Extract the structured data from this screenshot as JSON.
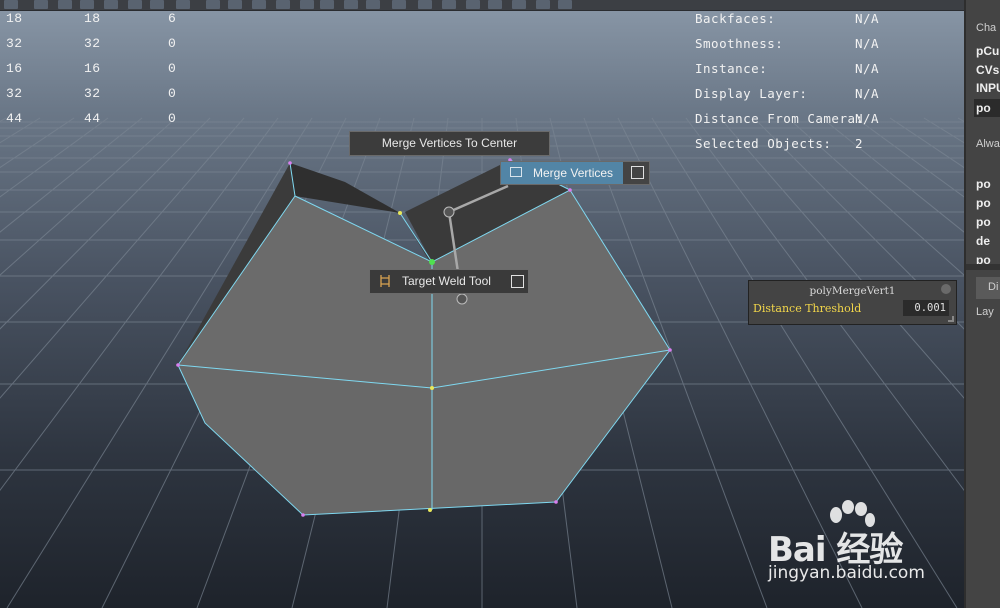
{
  "hud_left": {
    "rows": [
      [
        "18",
        "18",
        "6"
      ],
      [
        "32",
        "32",
        "0"
      ],
      [
        "16",
        "16",
        "0"
      ],
      [
        "32",
        "32",
        "0"
      ],
      [
        "44",
        "44",
        "0"
      ]
    ]
  },
  "hud_right": {
    "rows": [
      {
        "label": "Backfaces:",
        "value": "N/A"
      },
      {
        "label": "Smoothness:",
        "value": "N/A"
      },
      {
        "label": "Instance:",
        "value": "N/A"
      },
      {
        "label": "Display Layer:",
        "value": "N/A"
      },
      {
        "label": "Distance From Camera:",
        "value": "N/A"
      },
      {
        "label": "Selected Objects:",
        "value": "2"
      }
    ]
  },
  "marking_menu": {
    "merge_to_center": "Merge Vertices To Center",
    "merge_vertices": "Merge Vertices",
    "target_weld": "Target Weld Tool"
  },
  "merge_panel": {
    "title": "polyMergeVert1",
    "attr_label": "Distance Threshold",
    "attr_value": "0.001"
  },
  "side_panel": {
    "items": [
      "Cha",
      "pCu",
      "CVs",
      "INPU",
      "po",
      "Alwa",
      "po",
      "po",
      "po",
      "de",
      "po",
      "Di",
      "Lay"
    ]
  },
  "watermark": {
    "brand": "Bai 经验",
    "url": "jingyan.baidu.com"
  },
  "colors": {
    "accent_highlight": "#5285a6",
    "wire": "#7fd8f0",
    "threshold_label": "#f2d64a"
  }
}
